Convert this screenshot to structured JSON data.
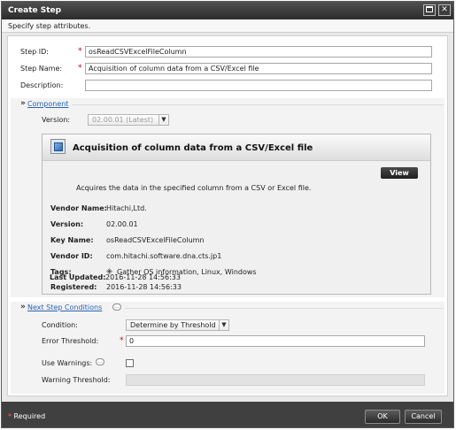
{
  "window": {
    "title": "Create Step",
    "maximize_icon": "maximize-icon",
    "close_icon": "close-icon"
  },
  "header": {
    "subtitle": "Specify step attributes."
  },
  "form": {
    "step_id": {
      "label": "Step ID:",
      "value": "osReadCSVExcelFileColumn",
      "required": "*"
    },
    "step_name": {
      "label": "Step Name:",
      "value": "Acquisition of column data from a CSV/Excel file",
      "required": "*"
    },
    "description": {
      "label": "Description:",
      "value": ""
    }
  },
  "component": {
    "chevron": "»",
    "title": "Component",
    "version_label": "Version:",
    "version_value": "02.00.01 (Latest)",
    "card": {
      "title": "Acquisition of column data from a CSV/Excel file",
      "view_label": "View",
      "description": "Acquires the data in the specified column from a CSV or Excel file.",
      "rows": [
        {
          "key": "Vendor Name:",
          "value": "Hitachi,Ltd."
        },
        {
          "key": "Version:",
          "value": "02.00.01"
        },
        {
          "key": "Key Name:",
          "value": "osReadCSVExcelFileColumn"
        },
        {
          "key": "Vendor ID:",
          "value": "com.hitachi.software.dna.cts.jp1"
        },
        {
          "key": "Tags:",
          "value": "Gather OS information, Linux, Windows"
        },
        {
          "key": "Registered:",
          "value": "2016-11-28 14:56:33"
        },
        {
          "key": "Last Updated:",
          "value": "2016-11-28 14:56:33"
        }
      ]
    }
  },
  "next_step": {
    "chevron": "»",
    "title": "Next Step Conditions",
    "condition_label": "Condition:",
    "condition_value": "Determine by Threshold",
    "error_threshold_label": "Error Threshold:",
    "error_threshold_value": "0",
    "required": "*",
    "use_warnings_label": "Use Warnings:",
    "warning_threshold_label": "Warning Threshold:",
    "warning_threshold_value": ""
  },
  "footer": {
    "required_star": "*",
    "required_text": " Required",
    "ok_label": "OK",
    "cancel_label": "Cancel"
  }
}
